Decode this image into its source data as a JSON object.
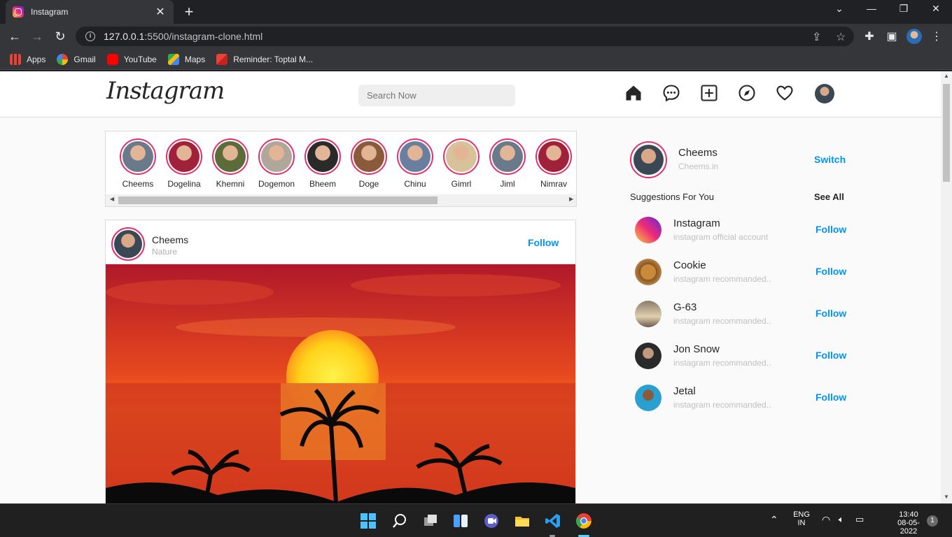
{
  "browser": {
    "tab_title": "Instagram",
    "tab_close": "✕",
    "new_tab": "+",
    "url_host": "127.0.0.1",
    "url_path": ":5500/instagram-clone.html",
    "bookmarks": [
      {
        "label": "Apps",
        "icon": "apps-grid-icon"
      },
      {
        "label": "Gmail",
        "icon": "google-icon"
      },
      {
        "label": "YouTube",
        "icon": "youtube-icon"
      },
      {
        "label": "Maps",
        "icon": "maps-icon"
      },
      {
        "label": "Reminder: Toptal M...",
        "icon": "gmail-icon"
      }
    ]
  },
  "header": {
    "logo": "Instagram",
    "search_placeholder": "Search Now"
  },
  "stories": [
    {
      "name": "Cheems",
      "color": "#6b7a8a"
    },
    {
      "name": "Dogelina",
      "color": "#a0213a"
    },
    {
      "name": "Khemni",
      "color": "#5c6b3a"
    },
    {
      "name": "Dogemon",
      "color": "#b0a79a"
    },
    {
      "name": "Bheem",
      "color": "#2a2a2a"
    },
    {
      "name": "Doge",
      "color": "#8a5a3a"
    },
    {
      "name": "Chinu",
      "color": "#6a7fa0"
    },
    {
      "name": "Gimrl",
      "color": "#d8c29a"
    },
    {
      "name": "Jiml",
      "color": "#6b7a8a"
    },
    {
      "name": "Nimrav",
      "color": "#a0213a"
    }
  ],
  "post": {
    "username": "Cheems",
    "location": "Nature",
    "follow_label": "Follow"
  },
  "sidebar": {
    "username": "Cheems",
    "handle": "Cheems.in",
    "switch_label": "Switch",
    "suggestions_title": "Suggestions For You",
    "see_all": "See All",
    "suggestions": [
      {
        "name": "Instagram",
        "sub": "instagram official account",
        "follow": "Follow"
      },
      {
        "name": "Cookie",
        "sub": "instagram recommanded..",
        "follow": "Follow"
      },
      {
        "name": "G-63",
        "sub": "instagram recommanded..",
        "follow": "Follow"
      },
      {
        "name": "Jon Snow",
        "sub": "instagram recommanded..",
        "follow": "Follow"
      },
      {
        "name": "Jetal",
        "sub": "instagram recommanded..",
        "follow": "Follow"
      }
    ]
  },
  "taskbar": {
    "lang_line1": "ENG",
    "lang_line2": "IN",
    "time": "13:40",
    "date": "08-05-2022",
    "notification_count": "1"
  }
}
